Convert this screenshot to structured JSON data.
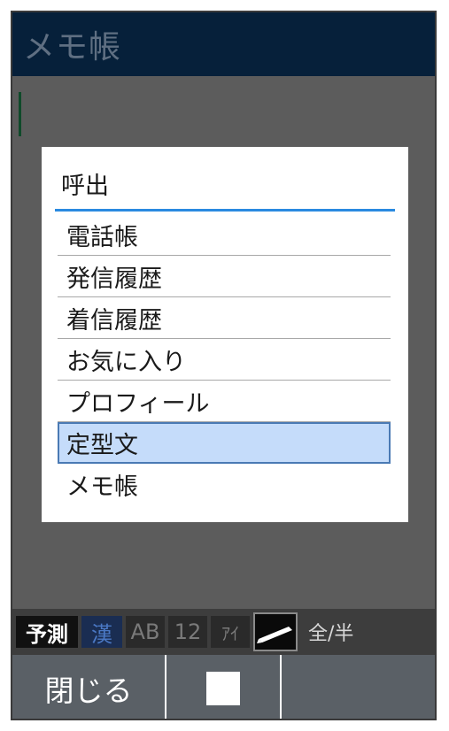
{
  "app": {
    "title": "メモ帳"
  },
  "dialog": {
    "title": "呼出",
    "items": [
      {
        "label": "電話帳",
        "selected": false
      },
      {
        "label": "発信履歴",
        "selected": false
      },
      {
        "label": "着信履歴",
        "selected": false
      },
      {
        "label": "お気に入り",
        "selected": false
      },
      {
        "label": "プロフィール",
        "selected": false
      },
      {
        "label": "定型文",
        "selected": true
      },
      {
        "label": "メモ帳",
        "selected": false
      }
    ]
  },
  "ime_bar": {
    "predict": "予測",
    "kanji": "漢",
    "alpha": "AB",
    "number": "12",
    "kana": "ｱｲ",
    "pen_icon": "pen-icon",
    "width_toggle": "全/半"
  },
  "softkeys": {
    "left": "閉じる",
    "center_icon": "stop-square-icon",
    "right": ""
  },
  "colors": {
    "titlebar_bg": "#06203a",
    "highlight_bg": "#c5dcfa",
    "accent_rule": "#2a8ae0",
    "softkey_bg": "#5a6066"
  }
}
